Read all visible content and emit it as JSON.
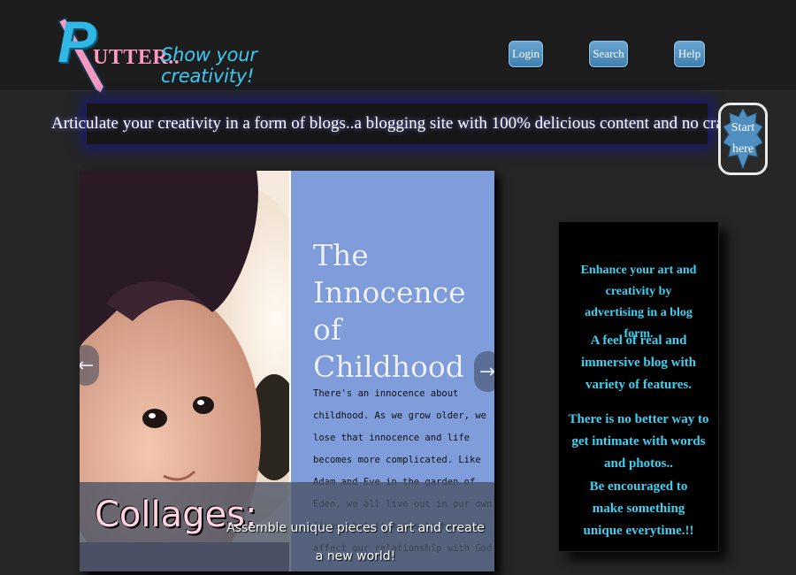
{
  "header": {
    "logo_letter": "P",
    "logo_rest": "UTTER..",
    "tagline": "Show your creativity!",
    "nav": {
      "login": "Login",
      "search": "Search",
      "help": "Help"
    }
  },
  "banner": {
    "text": "Articulate your creativity in a form of blogs..a blogging site with 100% delicious content and no crap!!"
  },
  "start_button": {
    "line1": "Start",
    "line2": "here"
  },
  "slider": {
    "panel_title_line1": "The Innocence of",
    "panel_title_line2": "Childhood",
    "panel_body": "There's an innocence about childhood. As we grow older, we lose that innocence and life becomes more complicated. Like Adam and Eve in the garden of Eden, we all live out in our own lives what it means to have sin affect our relationship with God",
    "caption_title": "Collages:",
    "caption_text": "Assemble unique pieces of art and create a new world!",
    "prev_arrow": "←",
    "next_arrow": "→"
  },
  "info": {
    "p1": "Enhance your art and creativity by advertising in a blog form.",
    "p2": "A feel of real and immersive blog with variety of features.",
    "p3": "There is no better way to get intimate with words and photos..",
    "p4": "Be encouraged to make something unique everytime.!!"
  },
  "colors": {
    "accent_cyan": "#3fd0f3",
    "logo_pink": "#ff9ac4",
    "button_blue": "#4f8fc0"
  }
}
